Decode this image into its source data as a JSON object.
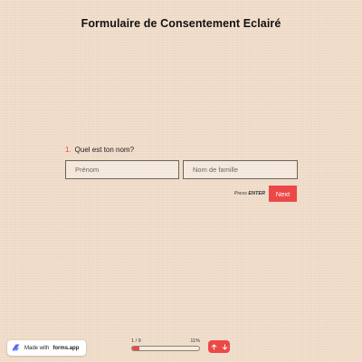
{
  "form": {
    "title": "Formulaire de Consentement Eclairé"
  },
  "question": {
    "number": "1.",
    "label": "Quel est ton nom?",
    "first_name": {
      "value": "",
      "placeholder": "Prénom"
    },
    "last_name": {
      "value": "",
      "placeholder": "Nom de famille"
    }
  },
  "submit": {
    "press_text": "Press",
    "key_text": "ENTER",
    "next_label": "Next"
  },
  "progress": {
    "label": "1 / 9",
    "percent_text": "11%",
    "percent": 11
  },
  "badge": {
    "made_with": "Made with",
    "brand": "forms.app",
    "icon": "forms-app-logo-icon"
  },
  "nav": {
    "up_icon": "arrow-up-icon",
    "down_icon": "arrow-down-icon"
  },
  "colors": {
    "accent": "#ec4848",
    "background": "#f3dfcb"
  }
}
